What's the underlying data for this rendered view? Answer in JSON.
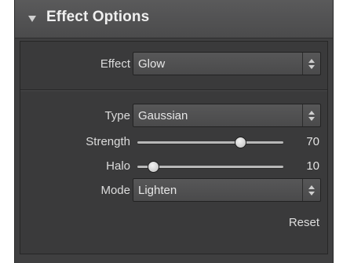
{
  "panel": {
    "title": "Effect Options",
    "effect": {
      "label": "Effect",
      "value": "Glow"
    },
    "type": {
      "label": "Type",
      "value": "Gaussian"
    },
    "strength": {
      "label": "Strength",
      "value": "70",
      "fraction": 0.7
    },
    "halo": {
      "label": "Halo",
      "value": "10",
      "fraction": 0.1
    },
    "mode": {
      "label": "Mode",
      "value": "Lighten"
    },
    "reset_label": "Reset"
  },
  "icons": {
    "collapse": "triangle-down-icon",
    "select_arrows": "up-down-arrows-icon",
    "slider_knob": "slider-knob"
  },
  "colors": {
    "panel_bg": "#3f3f40",
    "header_bg": "#535354",
    "text": "#dcdcdc"
  }
}
